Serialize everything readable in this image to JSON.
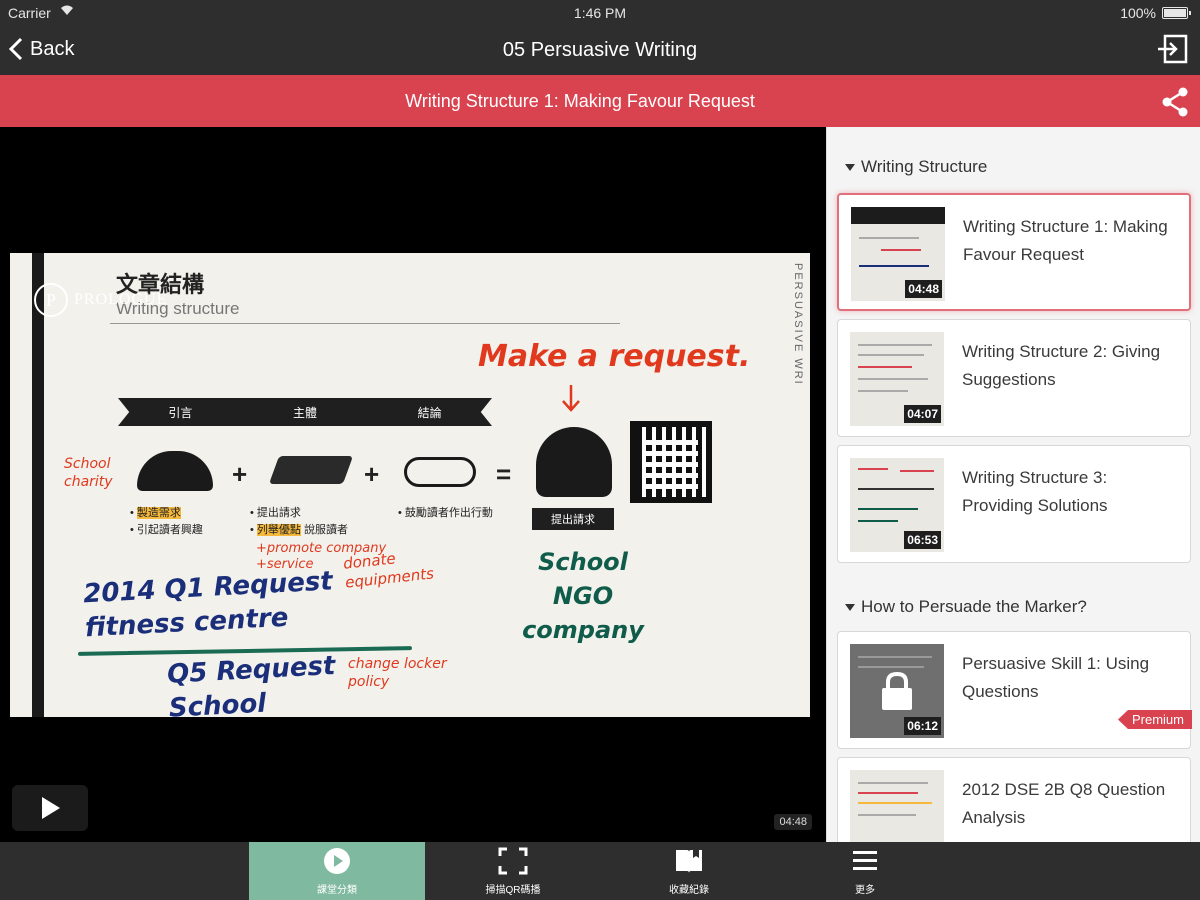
{
  "status_bar": {
    "carrier": "Carrier",
    "time": "1:46 PM",
    "battery": "100%"
  },
  "nav": {
    "back_label": "Back",
    "title": "05 Persuasive Writing"
  },
  "lesson": {
    "title": "Writing Structure 1: Making Favour Request"
  },
  "video": {
    "duration": "04:48",
    "slide": {
      "logo_text": "PROLOGUE",
      "heading_cn": "文章結構",
      "heading_en": "Writing structure",
      "side_text": "PERSUASIVE WRI",
      "banner": [
        "引言",
        "主體",
        "結論"
      ],
      "make_request": "Make a request.",
      "tag": "提出請求",
      "bullets_intro": [
        "製造需求",
        "引起讀者興趣"
      ],
      "bullets_body": [
        "提出請求",
        "列舉優點",
        "說服讀者"
      ],
      "bullets_end": "鼓勵讀者作出行動",
      "note_school": "School charity",
      "note_promote": "+promote company +service",
      "note_donate": "donate equipments",
      "blue_1": "2014 Q1 Request fitness centre",
      "blue_2": "Q5 Request School",
      "red_change": "change locker policy",
      "green": "School NGO company"
    }
  },
  "sidebar": {
    "sections": [
      {
        "title": "Writing Structure",
        "lessons": [
          {
            "title": "Writing Structure 1: Making Favour Request",
            "duration": "04:48"
          },
          {
            "title": "Writing Structure 2: Giving Suggestions",
            "duration": "04:07"
          },
          {
            "title": "Writing Structure 3: Providing Solutions",
            "duration": "06:53"
          }
        ]
      },
      {
        "title": "How to Persuade the Marker?",
        "lessons": [
          {
            "title": "Persuasive Skill 1: Using Questions",
            "duration": "06:12",
            "badge": "Premium"
          },
          {
            "title": "2012 DSE 2B Q8 Question Analysis"
          }
        ]
      }
    ]
  },
  "tabs": [
    {
      "label": "課堂分類",
      "icon": "play-circle-icon"
    },
    {
      "label": "掃描QR碼播",
      "icon": "scan-frame-icon"
    },
    {
      "label": "收藏紀錄",
      "icon": "book-icon"
    },
    {
      "label": "更多",
      "icon": "menu-icon"
    }
  ],
  "colors": {
    "accent_red": "#d9424f",
    "active_tab": "#7fb9a0",
    "bar_dark": "#2e2e2e"
  }
}
